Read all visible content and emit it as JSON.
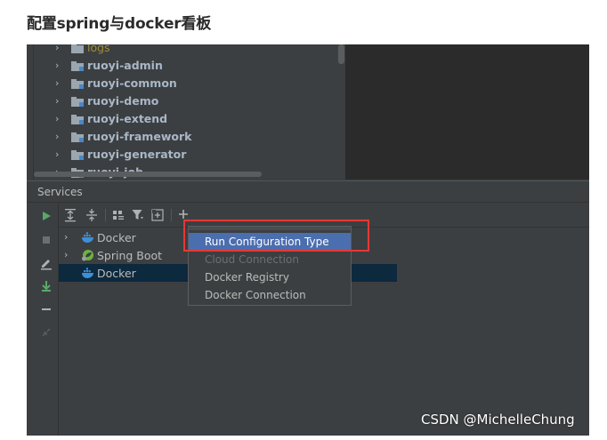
{
  "article": {
    "title": "配置spring与docker看板"
  },
  "tree": {
    "items": [
      {
        "label": "logs",
        "style": "yellow"
      },
      {
        "label": "ruoyi-admin"
      },
      {
        "label": "ruoyi-common"
      },
      {
        "label": "ruoyi-demo"
      },
      {
        "label": "ruoyi-extend"
      },
      {
        "label": "ruoyi-framework"
      },
      {
        "label": "ruoyi-generator"
      },
      {
        "label": "ruoyi-job"
      }
    ]
  },
  "services": {
    "title": "Services",
    "rows": [
      {
        "label": "Docker",
        "icon": "docker-icon",
        "expandable": true
      },
      {
        "label": "Spring Boot",
        "icon": "spring-boot-icon",
        "expandable": true
      },
      {
        "label": "Docker",
        "icon": "docker-icon",
        "expandable": false,
        "selected": true
      }
    ]
  },
  "popup": {
    "items": [
      {
        "label": "Run Configuration Type",
        "state": "highlight"
      },
      {
        "label": "Cloud Connection",
        "state": "disabled"
      },
      {
        "label": "Docker Registry",
        "state": "normal"
      },
      {
        "label": "Docker Connection",
        "state": "normal"
      }
    ]
  },
  "watermark": "CSDN @MichelleChung",
  "colors": {
    "highlight": "#4b6eaf",
    "annotation_red": "#e53935",
    "selection": "#0d293e",
    "run_green": "#59a869",
    "docker_blue": "#3d8fd6",
    "spring_green": "#6db33f"
  }
}
